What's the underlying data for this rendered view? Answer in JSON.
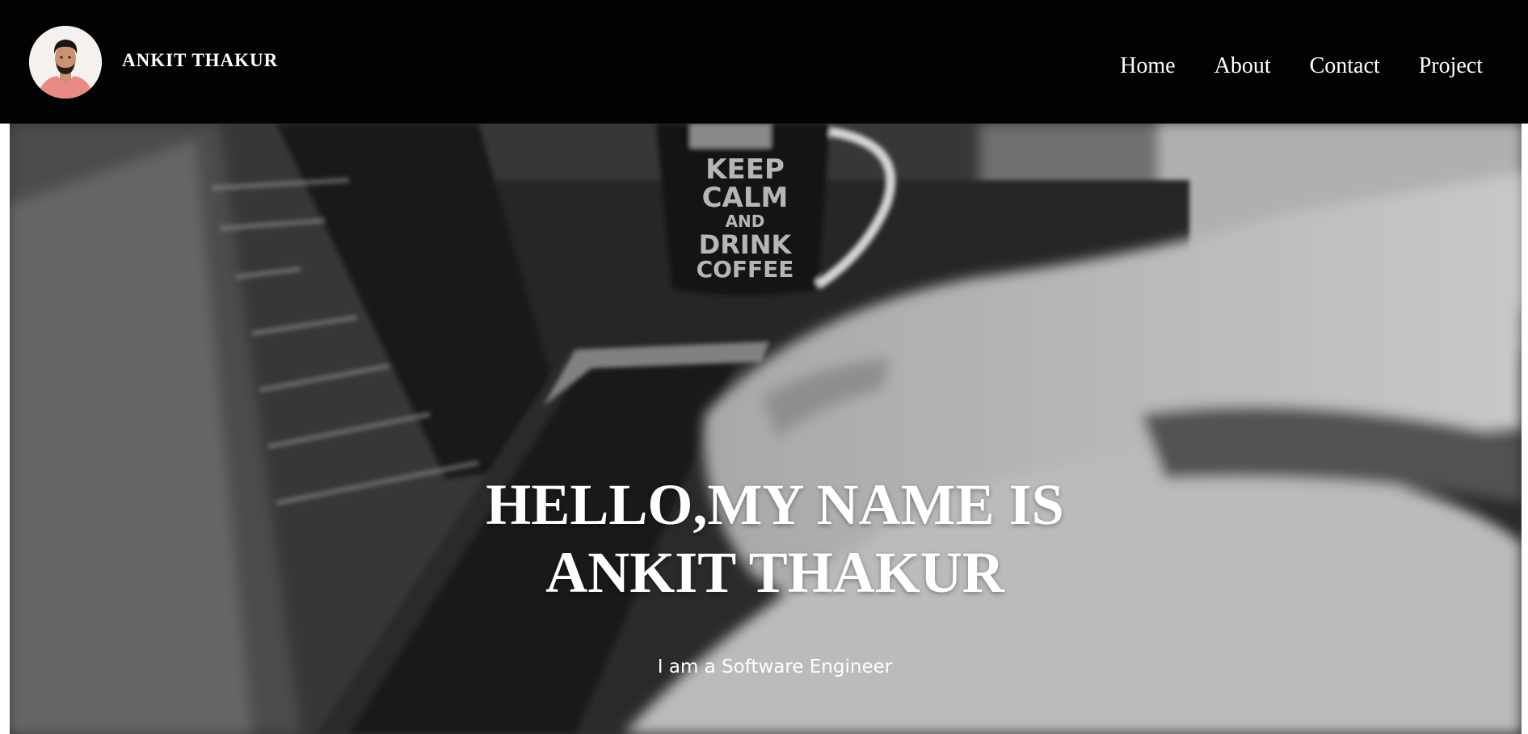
{
  "header": {
    "brand_name": "ANKIT THAKUR",
    "avatar_icon": "profile-photo",
    "nav": [
      {
        "label": "Home"
      },
      {
        "label": "About"
      },
      {
        "label": "Contact"
      },
      {
        "label": "Project"
      }
    ]
  },
  "hero": {
    "title_line1": "HELLO,MY NAME IS",
    "title_line2": "ANKIT THAKUR",
    "subtitle": "I am a Software Engineer",
    "mug_text": [
      "KEEP",
      "CALM",
      "AND",
      "DRINK",
      "COFFEE"
    ]
  },
  "colors": {
    "navbar_bg": "#020202",
    "text": "#ffffff",
    "avatar_shirt": "#e98a84"
  }
}
